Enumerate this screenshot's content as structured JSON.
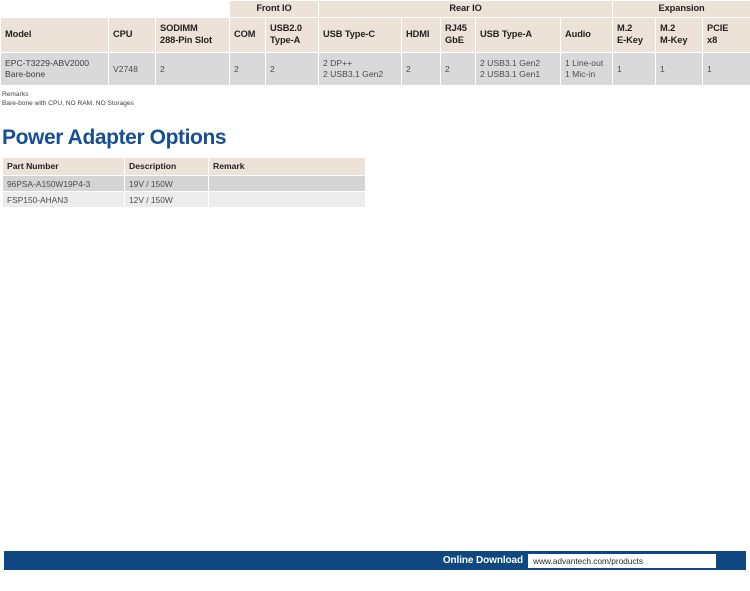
{
  "spec_table": {
    "group_headers": [
      {
        "label": "",
        "span": 3,
        "blank": true
      },
      {
        "label": "Front IO",
        "span": 2
      },
      {
        "label": "Rear IO",
        "span": 5
      },
      {
        "label": "Expansion",
        "span": 3
      }
    ],
    "columns": [
      "Model",
      "CPU",
      "SODIMM\n288-Pin Slot",
      "COM",
      "USB2.0\nType-A",
      "USB Type-C",
      "HDMI",
      "RJ45\nGbE",
      "USB Type-A",
      "Audio",
      "M.2\nE-Key",
      "M.2\nM-Key",
      "PCIE\nx8"
    ],
    "rows": [
      {
        "model": "EPC-T3229-ABV2000\nBare-bone",
        "cpu": "V2748",
        "sodimm": "2",
        "com": "2",
        "usb20_type_a": "2",
        "usb_type_c": "2 DP++\n2 USB3.1 Gen2",
        "hdmi": "2",
        "rj45_gbe": "2",
        "usb_type_a": "2 USB3.1 Gen2\n2 USB3.1 Gen1",
        "audio": "1 Line-out\n1 Mic-in",
        "m2_e_key": "1",
        "m2_m_key": "1",
        "pcie_x8": "1"
      }
    ]
  },
  "remarks": {
    "title": "Remarks",
    "text": "Bare-bone with CPU, NO RAM, NO Storages"
  },
  "power_adapter": {
    "heading": "Power Adapter Options",
    "columns": [
      "Part Number",
      "Description",
      "Remark"
    ],
    "rows": [
      {
        "part_number": "96PSA-A150W19P4-3",
        "description": "19V / 150W",
        "remark": ""
      },
      {
        "part_number": "FSP150-AHAN3",
        "description": "12V / 150W",
        "remark": ""
      }
    ]
  },
  "footer": {
    "label": "Online Download",
    "url": "www.advantech.com/products"
  },
  "colors": {
    "header_beige": "#ece2d8",
    "row_gray": "#d9d9d9",
    "row_gray_alt": "#ececec",
    "brand_blue": "#174f96",
    "footer_blue": "#0f4880"
  }
}
